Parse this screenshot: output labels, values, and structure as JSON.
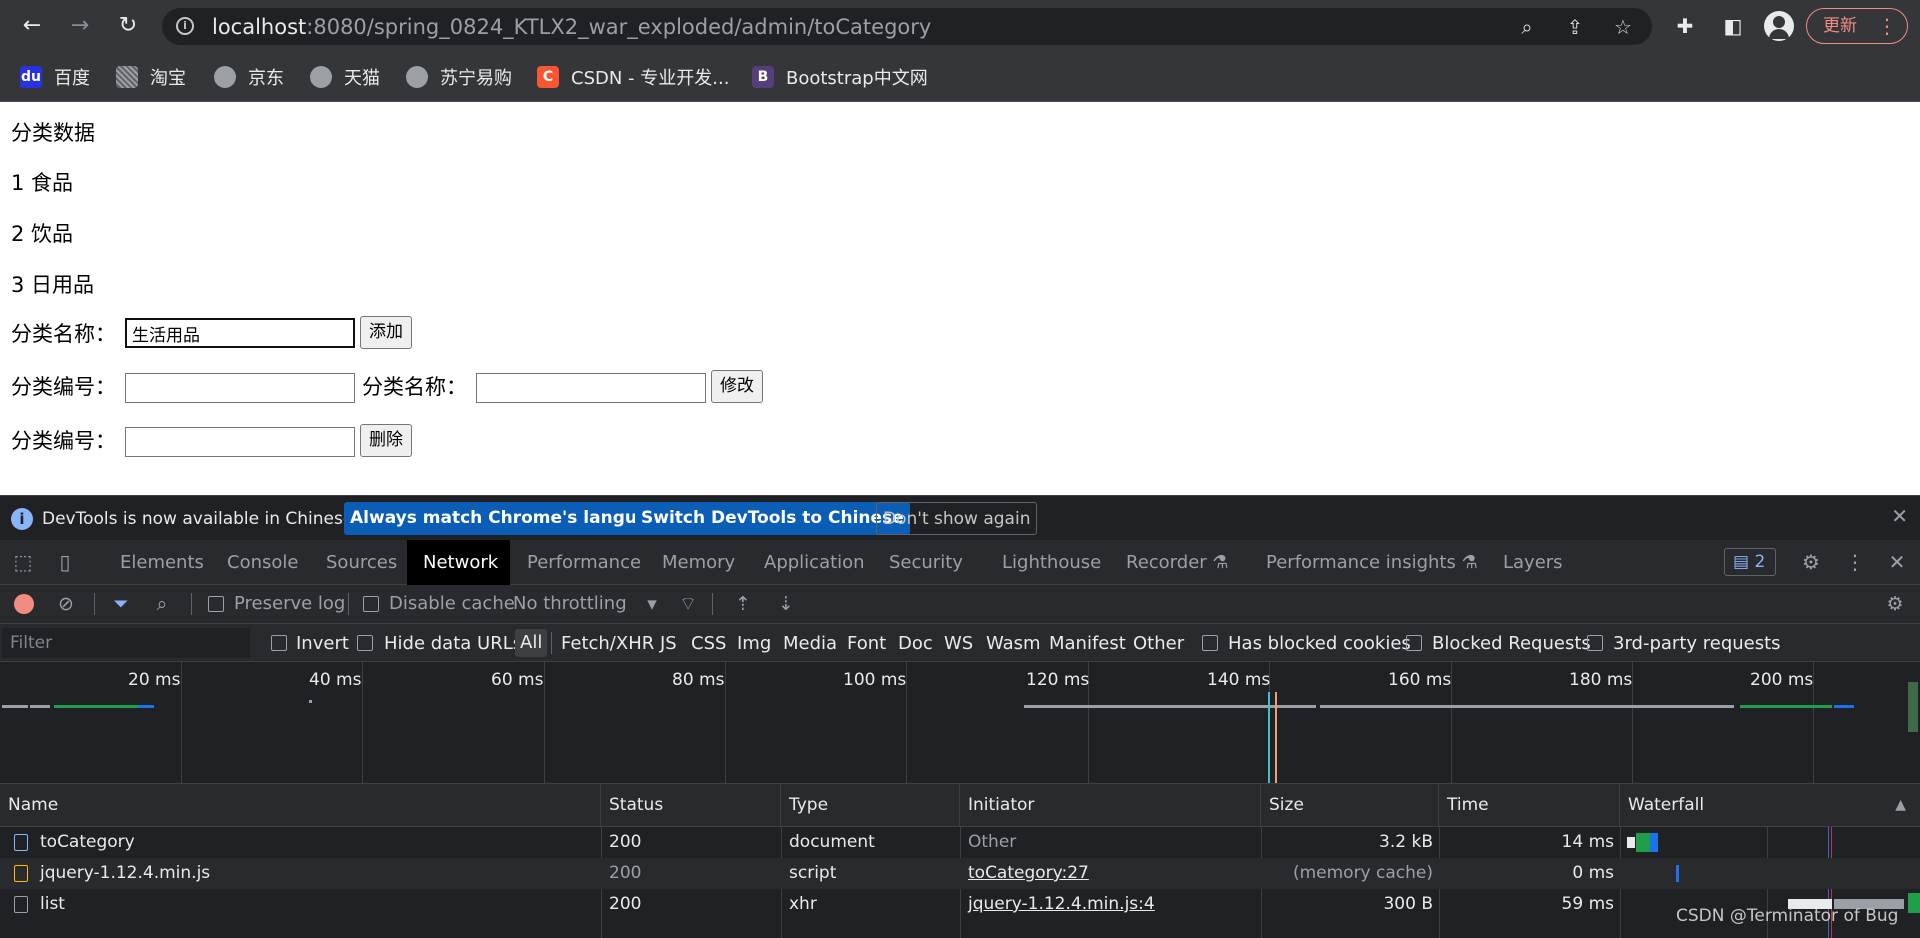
{
  "browser": {
    "url_host": "localhost",
    "url_path": ":8080/spring_0824_KTLX2_war_exploded/admin/toCategory",
    "update_label": "更新",
    "bookmarks": [
      {
        "label": "百度",
        "fav": "du"
      },
      {
        "label": "淘宝",
        "fav": ""
      },
      {
        "label": "京东",
        "fav": ""
      },
      {
        "label": "天猫",
        "fav": ""
      },
      {
        "label": "苏宁易购",
        "fav": ""
      },
      {
        "label": "CSDN - 专业开发...",
        "fav": "C"
      },
      {
        "label": "Bootstrap中文网",
        "fav": "B"
      }
    ]
  },
  "page": {
    "heading": "分类数据",
    "categories": [
      "1 食品",
      "2 饮品",
      "3 日用品"
    ],
    "add_form": {
      "label": "分类名称：",
      "value": "生活用品",
      "button": "添加"
    },
    "edit_form": {
      "id_label": "分类编号：",
      "name_label": "分类名称：",
      "button": "修改"
    },
    "delete_form": {
      "id_label": "分类编号：",
      "button": "删除"
    }
  },
  "devtools": {
    "infobar": {
      "message": "DevTools is now available in Chinese!",
      "btn_match": "Always match Chrome's language",
      "btn_switch": "Switch DevTools to Chinese",
      "btn_dismiss": "Don't show again"
    },
    "tabs": [
      "Elements",
      "Console",
      "Sources",
      "Network",
      "Performance",
      "Memory",
      "Application",
      "Security",
      "Lighthouse",
      "Recorder",
      "Performance insights",
      "Layers"
    ],
    "active_tab": "Network",
    "issues_count": "2",
    "toolbar": {
      "preserve_log": "Preserve log",
      "disable_cache": "Disable cache",
      "throttling": "No throttling"
    },
    "filter": {
      "placeholder": "Filter",
      "invert": "Invert",
      "hide_data_urls": "Hide data URLs",
      "types": [
        "All",
        "Fetch/XHR",
        "JS",
        "CSS",
        "Img",
        "Media",
        "Font",
        "Doc",
        "WS",
        "Wasm",
        "Manifest",
        "Other"
      ],
      "has_blocked_cookies": "Has blocked cookies",
      "blocked_requests": "Blocked Requests",
      "third_party": "3rd-party requests"
    },
    "overview_ticks": [
      "20 ms",
      "40 ms",
      "60 ms",
      "80 ms",
      "100 ms",
      "120 ms",
      "140 ms",
      "160 ms",
      "180 ms",
      "200 ms"
    ],
    "columns": [
      "Name",
      "Status",
      "Type",
      "Initiator",
      "Size",
      "Time",
      "Waterfall"
    ],
    "sort_indicator": "▲",
    "requests": [
      {
        "name": "toCategory",
        "status": "200",
        "type": "document",
        "initiator": "Other",
        "size": "3.2 kB",
        "time": "14 ms"
      },
      {
        "name": "jquery-1.12.4.min.js",
        "status": "200",
        "type": "script",
        "initiator": "toCategory:27",
        "size": "(memory cache)",
        "time": "0 ms"
      },
      {
        "name": "list",
        "status": "200",
        "type": "xhr",
        "initiator": "jquery-1.12.4.min.js:4",
        "size": "300 B",
        "time": "59 ms"
      }
    ]
  },
  "watermark": "CSDN @Terminator of Bug",
  "colors": {
    "accent_blue": "#0b5db5",
    "record_red": "#f28b82",
    "devtools_bg": "#202124"
  }
}
